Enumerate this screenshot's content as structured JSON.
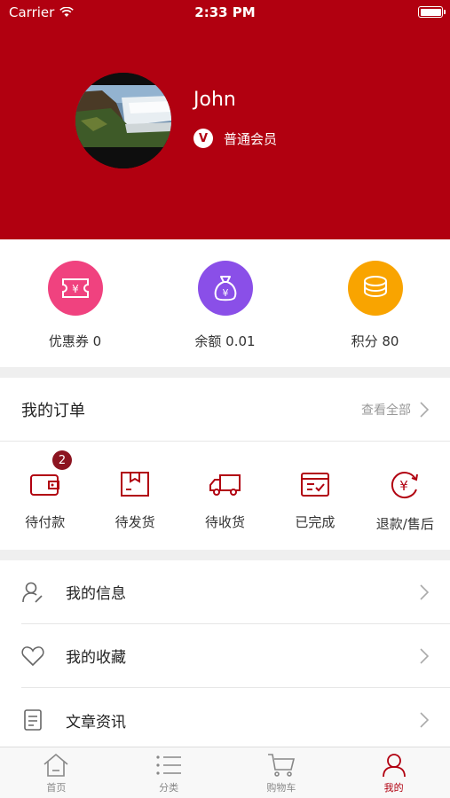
{
  "status_bar": {
    "carrier": "Carrier",
    "time": "2:33 PM"
  },
  "profile": {
    "name": "John",
    "member_badge": "V",
    "member_level": "普通会员"
  },
  "stats": [
    {
      "label": "优惠券 0",
      "icon": "coupon-icon",
      "color": "#f0427f"
    },
    {
      "label": "余额 0.01",
      "icon": "money-bag-icon",
      "color": "#8a4fe8"
    },
    {
      "label": "积分 80",
      "icon": "coins-icon",
      "color": "#f9a400"
    }
  ],
  "orders": {
    "title": "我的订单",
    "view_all": "查看全部",
    "items": [
      {
        "label": "待付款",
        "icon": "wallet-icon",
        "badge": "2"
      },
      {
        "label": "待发货",
        "icon": "package-icon"
      },
      {
        "label": "待收货",
        "icon": "truck-icon"
      },
      {
        "label": "已完成",
        "icon": "completed-icon"
      },
      {
        "label": "退款/售后",
        "icon": "refund-icon"
      }
    ]
  },
  "menu": [
    {
      "label": "我的信息",
      "icon": "user-edit-icon"
    },
    {
      "label": "我的收藏",
      "icon": "heart-icon"
    },
    {
      "label": "文章资讯",
      "icon": "article-icon"
    }
  ],
  "tabs": [
    {
      "label": "首页",
      "icon": "home-icon"
    },
    {
      "label": "分类",
      "icon": "list-icon"
    },
    {
      "label": "购物车",
      "icon": "cart-icon"
    },
    {
      "label": "我的",
      "icon": "user-icon",
      "active": true
    }
  ],
  "colors": {
    "brand": "#b10010",
    "badge": "#8c1420",
    "inactive": "#888888"
  }
}
